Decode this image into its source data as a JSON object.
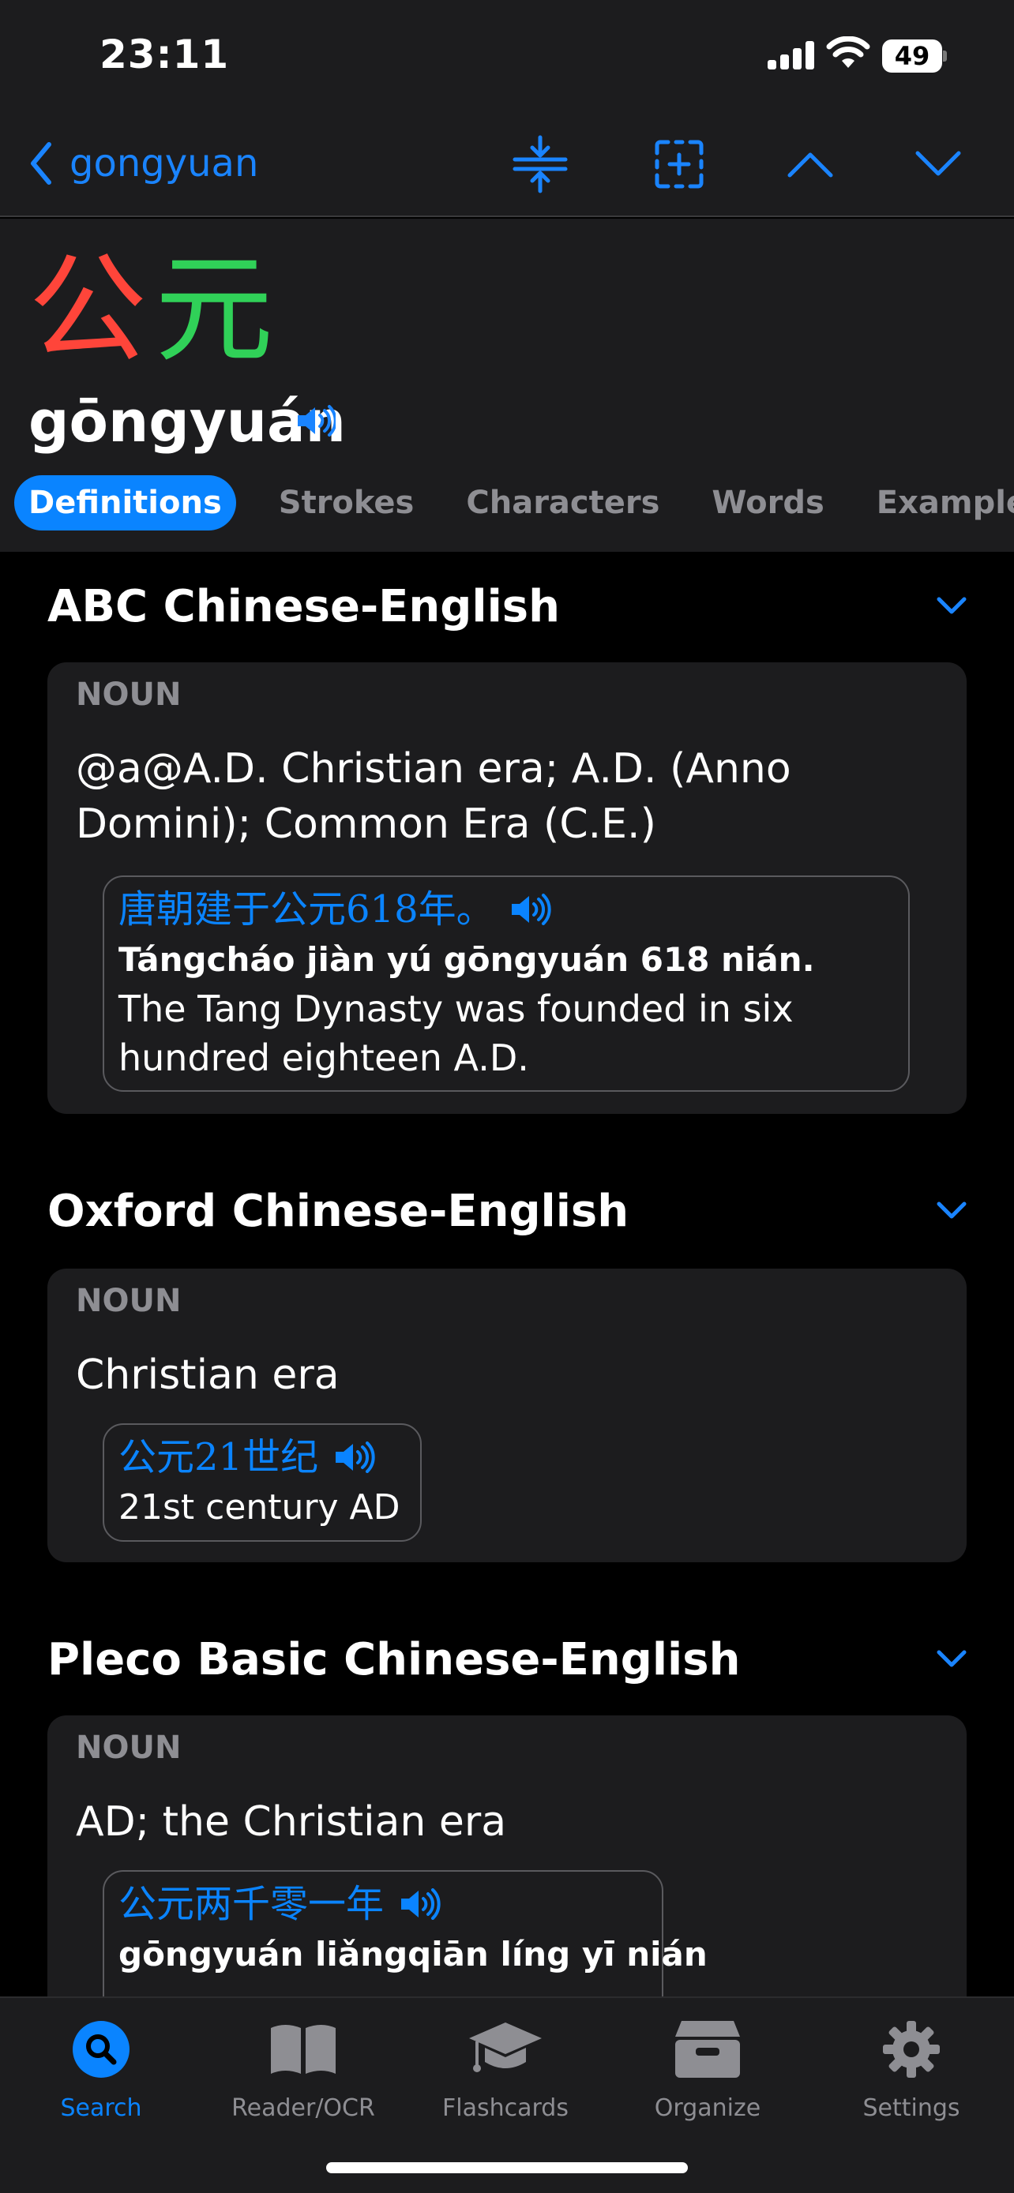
{
  "status": {
    "time": "23:11",
    "battery": "49"
  },
  "nav": {
    "back_label": "gongyuan"
  },
  "entry": {
    "char1": "公",
    "char2": "元",
    "pinyin": "gōngyuán"
  },
  "tabs": [
    "Definitions",
    "Strokes",
    "Characters",
    "Words",
    "Examples"
  ],
  "sections": [
    {
      "title": "ABC Chinese-English",
      "pos": "NOUN",
      "definition": "@a@A.D. Christian era; A.D. (Anno Domini); Common Era (C.E.)",
      "example": {
        "chinese": "唐朝建于公元618年。",
        "pinyin_pre": "Tángcháo jiàn yú ",
        "pinyin_key": "gōngyuán",
        "pinyin_post": " 618 nián.",
        "english": "The Tang Dynasty was founded in six hundred eighteen A.D."
      }
    },
    {
      "title": "Oxford Chinese-English",
      "pos": "NOUN",
      "definition": "Christian era",
      "example": {
        "chinese": "公元21世纪",
        "english": "21st century AD"
      }
    },
    {
      "title": "Pleco Basic Chinese-English",
      "pos": "NOUN",
      "definition": "AD; the Christian era",
      "example": {
        "chinese": "公元两千零一年",
        "pinyin_key": "gōngyuán",
        "pinyin_post": " liǎngqiān líng yī nián"
      }
    }
  ],
  "tabbar": [
    {
      "label": "Search",
      "icon": "search-icon"
    },
    {
      "label": "Reader/OCR",
      "icon": "book-icon"
    },
    {
      "label": "Flashcards",
      "icon": "graduation-cap-icon"
    },
    {
      "label": "Organize",
      "icon": "archive-box-icon"
    },
    {
      "label": "Settings",
      "icon": "gear-icon"
    }
  ],
  "colors": {
    "accent": "#0a84ff",
    "char1": "#ff453a",
    "char2": "#30d158",
    "card": "#1c1c1e"
  }
}
